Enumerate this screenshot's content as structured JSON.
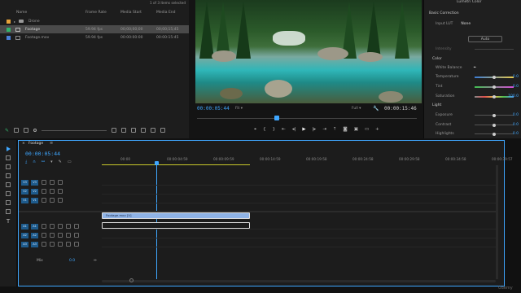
{
  "project": {
    "items_selected": "1 of 3 items selected",
    "columns": [
      "Name",
      "Frame Rate",
      "Media Start",
      "Media End"
    ],
    "rows": [
      {
        "name": "Drone",
        "color": "#e8a33a",
        "is_folder": true,
        "frame_rate": "",
        "start": "",
        "end": "",
        "selected": false
      },
      {
        "name": "Footage",
        "color": "#33b36b",
        "is_folder": false,
        "frame_rate": "59.94 fps",
        "start": "00;00;00;00",
        "end": "00;00;15;45",
        "selected": true
      },
      {
        "name": "Footage.mov",
        "color": "#4a7fd6",
        "is_folder": false,
        "frame_rate": "59.94 fps",
        "start": "00:00:00:00",
        "end": "00:00:15:45",
        "selected": false
      }
    ]
  },
  "monitor": {
    "current_tc": "00:00:05:44",
    "duration_tc": "00:00:15:46",
    "zoom": "Fit",
    "quality": "Full"
  },
  "lumetri": {
    "title": "Lumetri Color",
    "basic_correction": "Basic Correction",
    "input_lut_label": "Input LUT",
    "input_lut_value": "None",
    "auto": "Auto",
    "intensity": "Intensity",
    "color_header": "Color",
    "white_balance": "White Balance",
    "controls": [
      {
        "label": "Temperature",
        "value": "0.0",
        "pos": 0.5,
        "kind": "temp"
      },
      {
        "label": "Tint",
        "value": "0.0",
        "pos": 0.5,
        "kind": "tint"
      },
      {
        "label": "Saturation",
        "value": "100.0",
        "pos": 0.5,
        "kind": "sat"
      }
    ],
    "light_header": "Light",
    "light": [
      {
        "label": "Exposure",
        "value": "0.0",
        "pos": 0.5
      },
      {
        "label": "Contrast",
        "value": "0.0",
        "pos": 0.5
      },
      {
        "label": "Highlights",
        "value": "0.0",
        "pos": 0.5
      }
    ]
  },
  "timeline": {
    "tab": "Footage",
    "tc": "00:00:05:44",
    "ruler": [
      "00:00",
      "00:00:04:59",
      "00:00:09:59",
      "00:00:14:59",
      "00:00:19:58",
      "00:00:24:58",
      "00:00:29:58",
      "00:00:34:58",
      "00:00:39:57"
    ],
    "video_tracks": [
      "V3",
      "V2",
      "V1"
    ],
    "audio_tracks": [
      "A1",
      "A2",
      "A3"
    ],
    "mix_label": "Mix",
    "mix_value": "0.0",
    "video_clip": "Footage.mov [V]",
    "watermark": "Udemy"
  }
}
